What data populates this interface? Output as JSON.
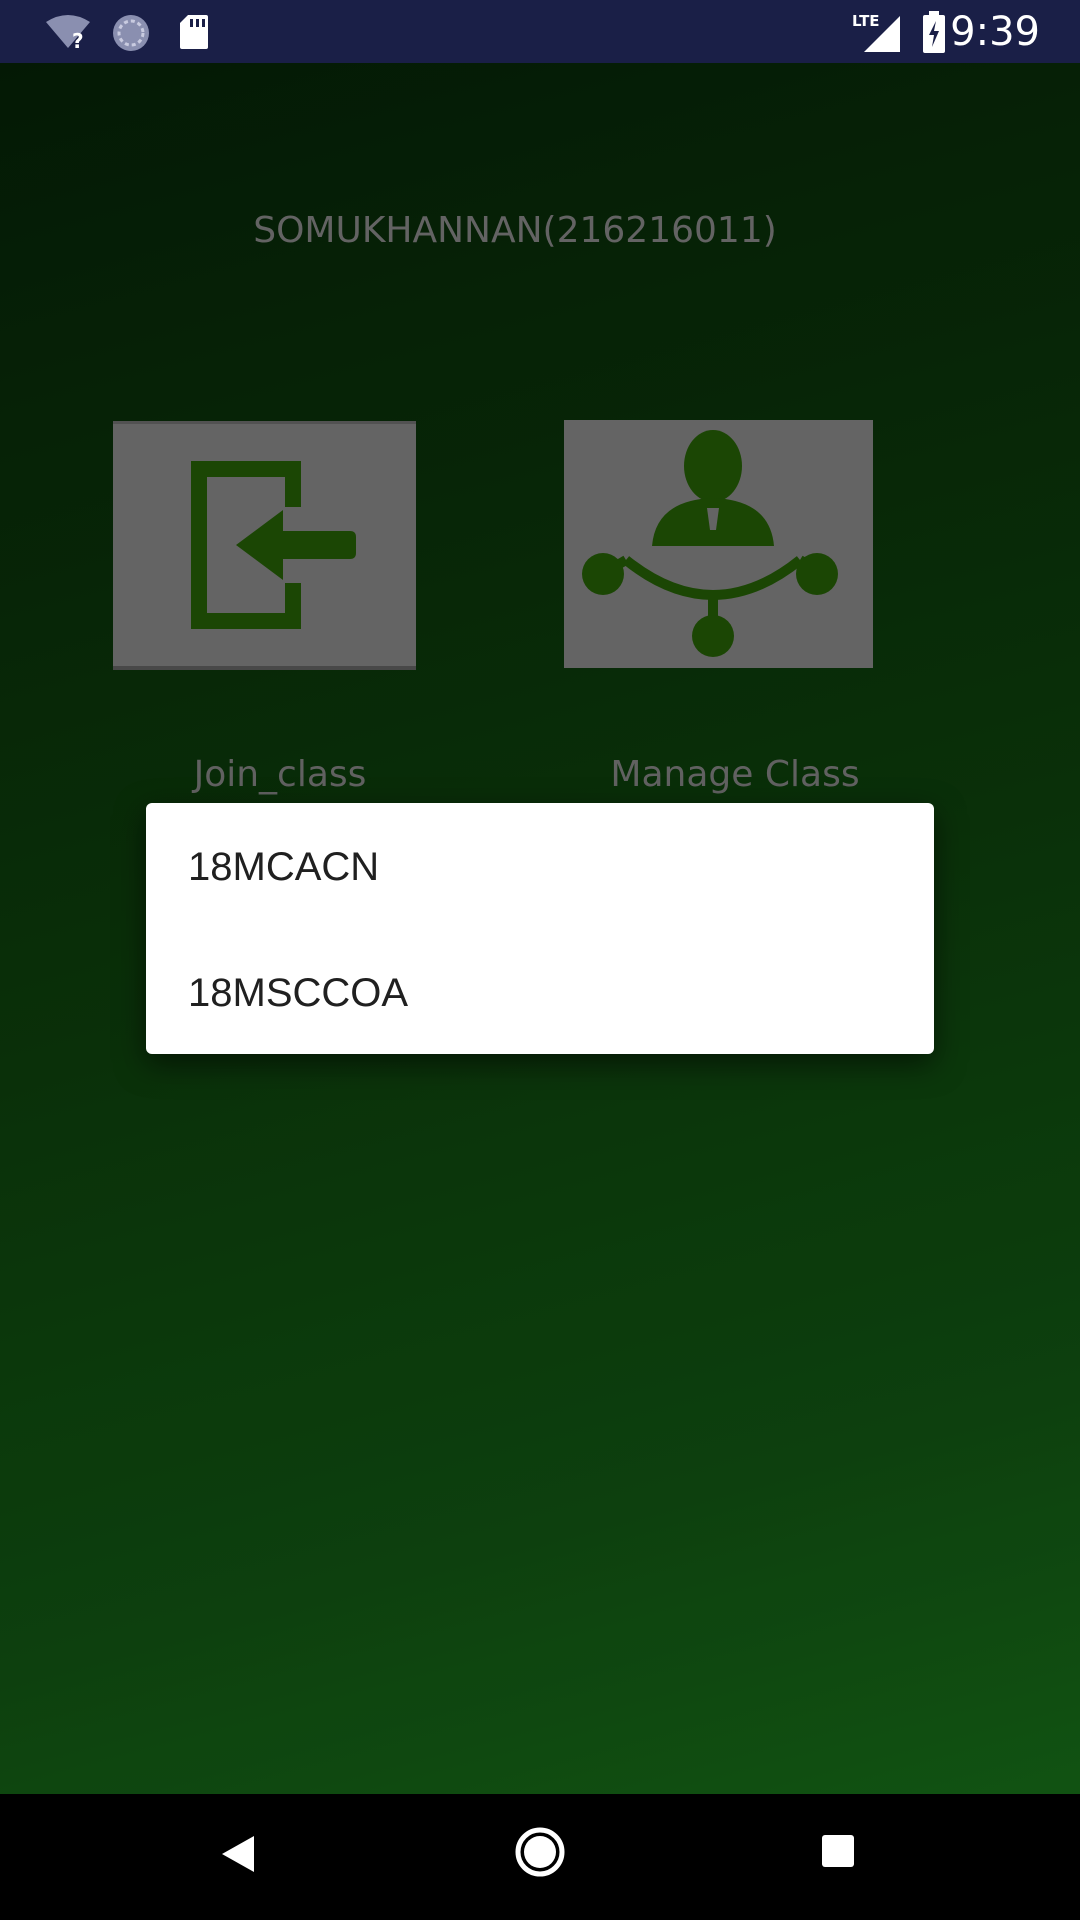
{
  "status_bar": {
    "time": "9:39",
    "network_label": "LTE",
    "icons": [
      "wifi-unknown-icon",
      "sync-icon",
      "sd-card-icon",
      "signal-icon",
      "battery-charging-icon"
    ]
  },
  "header": {
    "user_title": "SOMUKHANNAN(216216011)"
  },
  "tiles": {
    "join": {
      "label": "Join_class",
      "icon": "join-class-icon"
    },
    "manage": {
      "label": "Manage Class",
      "icon": "manage-class-icon"
    }
  },
  "dialog": {
    "options": [
      {
        "label": "18MCACN"
      },
      {
        "label": "18MSCCOA"
      }
    ]
  },
  "nav_bar": {
    "icons": [
      "back-icon",
      "home-icon",
      "recents-icon"
    ]
  },
  "colors": {
    "status_bar_bg": "#1a1f47",
    "tile_bg": "#6d6d6d",
    "icon_green": "#1e4d05",
    "dialog_bg": "#ffffff"
  }
}
